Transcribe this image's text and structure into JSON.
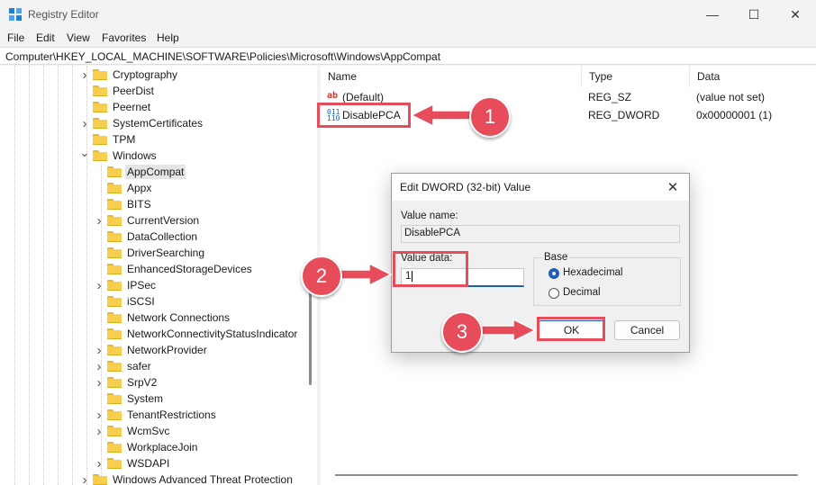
{
  "window": {
    "title": "Registry Editor",
    "minimize_glyph": "—",
    "maximize_glyph": "☐",
    "close_glyph": "✕"
  },
  "menu": [
    "File",
    "Edit",
    "View",
    "Favorites",
    "Help"
  ],
  "address": "Computer\\HKEY_LOCAL_MACHINE\\SOFTWARE\\Policies\\Microsoft\\Windows\\AppCompat",
  "tree": [
    {
      "label": "Cryptography",
      "level": 0,
      "expander": "collapsed"
    },
    {
      "label": "PeerDist",
      "level": 0,
      "expander": "none"
    },
    {
      "label": "Peernet",
      "level": 0,
      "expander": "none"
    },
    {
      "label": "SystemCertificates",
      "level": 0,
      "expander": "collapsed"
    },
    {
      "label": "TPM",
      "level": 0,
      "expander": "none"
    },
    {
      "label": "Windows",
      "level": 0,
      "expander": "expanded"
    },
    {
      "label": "AppCompat",
      "level": 1,
      "expander": "none",
      "selected": true
    },
    {
      "label": "Appx",
      "level": 1,
      "expander": "none"
    },
    {
      "label": "BITS",
      "level": 1,
      "expander": "none"
    },
    {
      "label": "CurrentVersion",
      "level": 1,
      "expander": "collapsed"
    },
    {
      "label": "DataCollection",
      "level": 1,
      "expander": "none"
    },
    {
      "label": "DriverSearching",
      "level": 1,
      "expander": "none"
    },
    {
      "label": "EnhancedStorageDevices",
      "level": 1,
      "expander": "none"
    },
    {
      "label": "IPSec",
      "level": 1,
      "expander": "collapsed"
    },
    {
      "label": "iSCSI",
      "level": 1,
      "expander": "none"
    },
    {
      "label": "Network Connections",
      "level": 1,
      "expander": "none"
    },
    {
      "label": "NetworkConnectivityStatusIndicator",
      "level": 1,
      "expander": "none"
    },
    {
      "label": "NetworkProvider",
      "level": 1,
      "expander": "collapsed"
    },
    {
      "label": "safer",
      "level": 1,
      "expander": "collapsed"
    },
    {
      "label": "SrpV2",
      "level": 1,
      "expander": "collapsed"
    },
    {
      "label": "System",
      "level": 1,
      "expander": "none"
    },
    {
      "label": "TenantRestrictions",
      "level": 1,
      "expander": "collapsed"
    },
    {
      "label": "WcmSvc",
      "level": 1,
      "expander": "collapsed"
    },
    {
      "label": "WorkplaceJoin",
      "level": 1,
      "expander": "none"
    },
    {
      "label": "WSDAPI",
      "level": 1,
      "expander": "collapsed"
    },
    {
      "label": "Windows Advanced Threat Protection",
      "level": 0,
      "expander": "collapsed"
    }
  ],
  "list": {
    "columns": [
      "Name",
      "Type",
      "Data"
    ],
    "rows": [
      {
        "name": "(Default)",
        "type": "REG_SZ",
        "data": "(value not set)",
        "icon": "string-value-icon"
      },
      {
        "name": "DisablePCA",
        "type": "REG_DWORD",
        "data": "0x00000001 (1)",
        "icon": "dword-value-icon"
      }
    ]
  },
  "dialog": {
    "title": "Edit DWORD (32-bit) Value",
    "close_glyph": "✕",
    "value_name_label": "Value name:",
    "value_name": "DisablePCA",
    "value_data_label": "Value data:",
    "value_data": "1",
    "base_label": "Base",
    "radio_hex": "Hexadecimal",
    "radio_dec": "Decimal",
    "base_selected": "Hexadecimal",
    "ok_label": "OK",
    "cancel_label": "Cancel"
  },
  "annotations": {
    "step1": "1",
    "step2": "2",
    "step3": "3",
    "color": "#e74c5a"
  }
}
